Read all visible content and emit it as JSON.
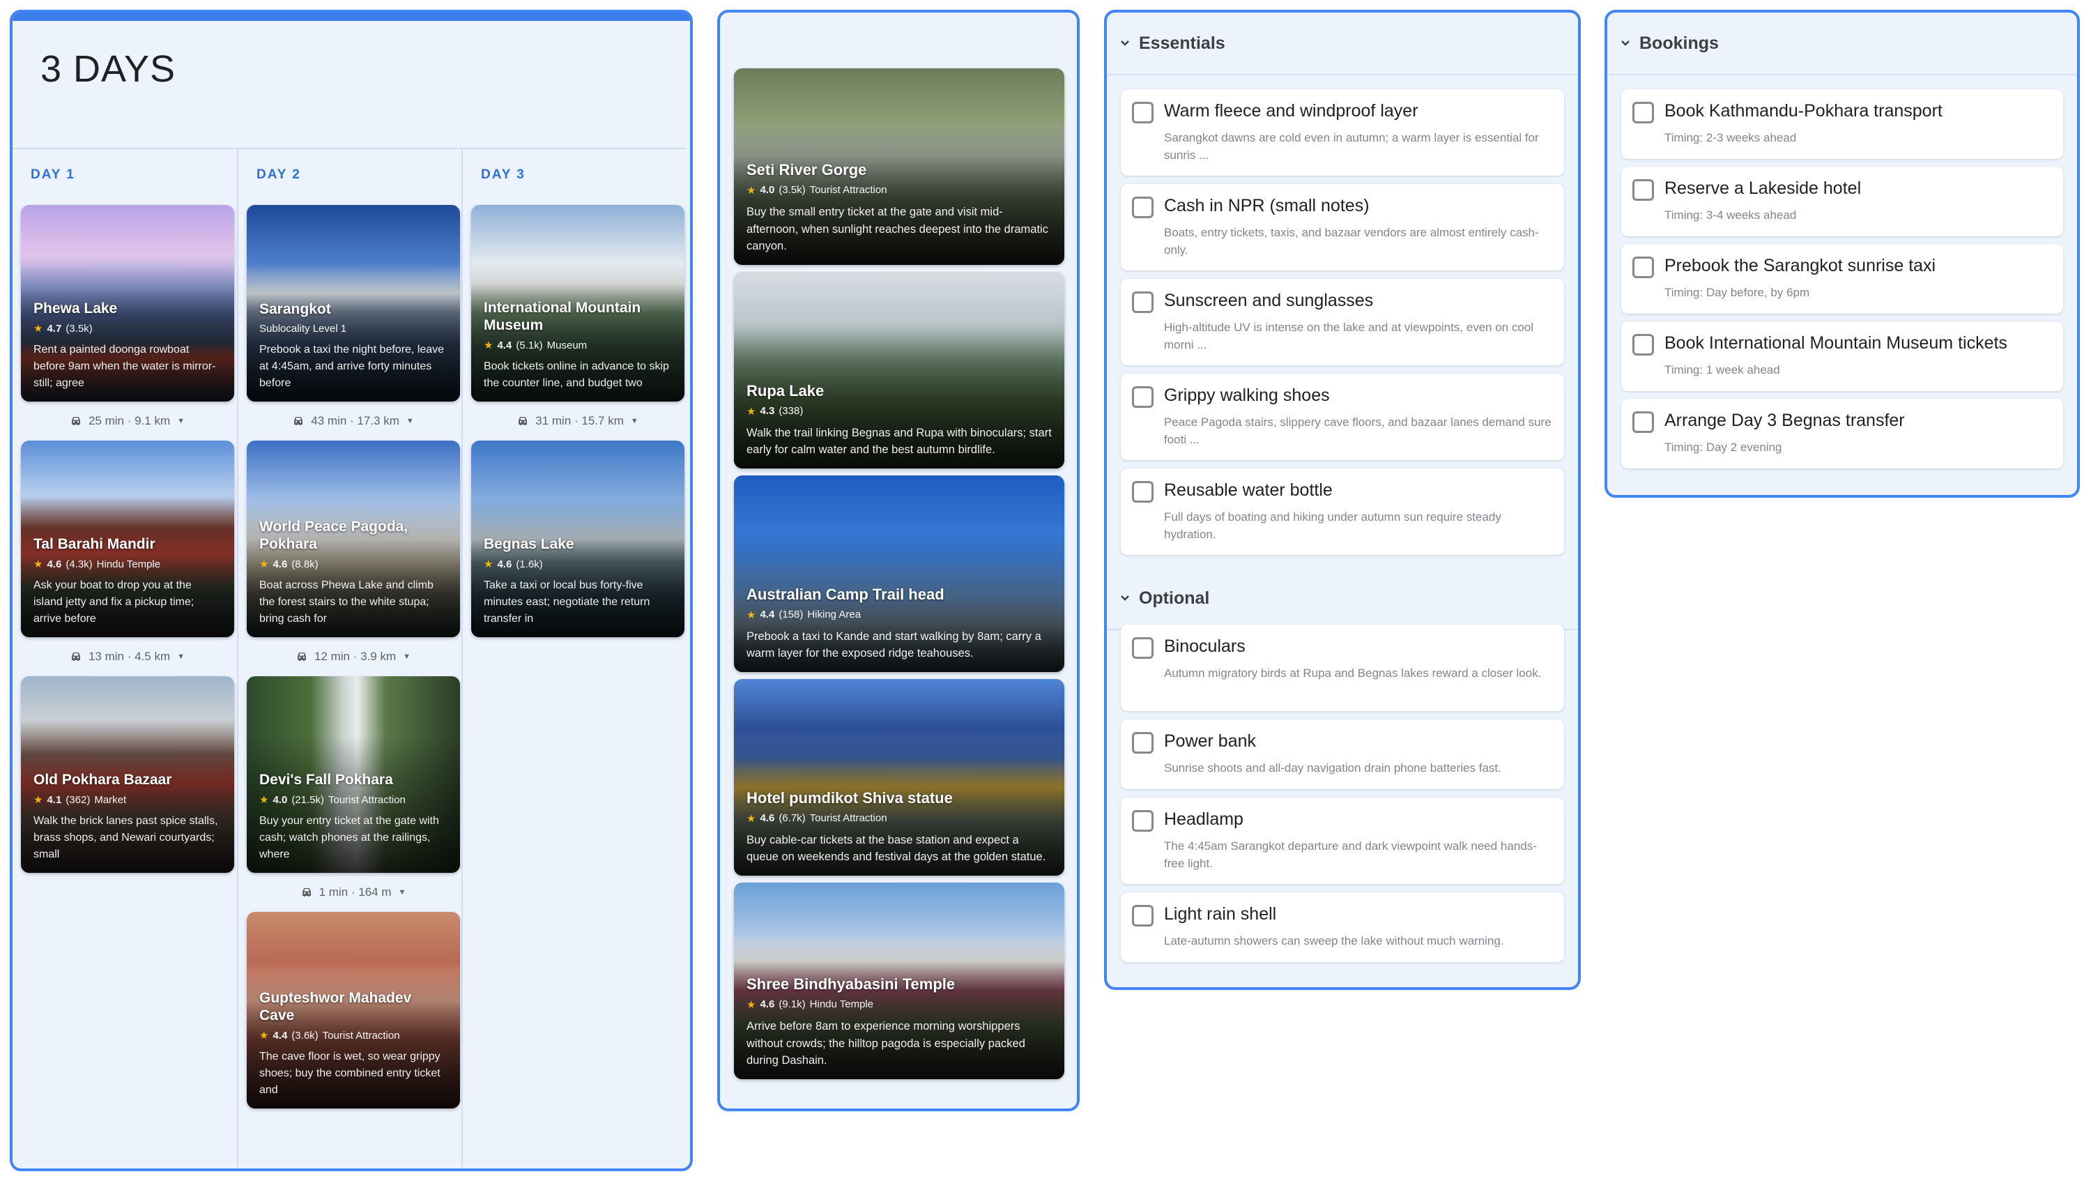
{
  "colors": {
    "accent": "#4285f4",
    "panel_bg": "#edf3fd",
    "star": "#fbbc04",
    "day_label": "#2b6fd9"
  },
  "itinerary": {
    "title": "3 DAYS",
    "days": [
      {
        "label": "DAY 1",
        "places": [
          {
            "name": "Phewa Lake",
            "rating": "4.7",
            "count": "(3.5k)",
            "category": "",
            "desc": "Rent a painted doonga rowboat before 9am when the water is mirror-still; agree"
          },
          {
            "name": "Tal Barahi Mandir",
            "rating": "4.6",
            "count": "(4.3k)",
            "category": "Hindu Temple",
            "desc": "Ask your boat to drop you at the island jetty and fix a pickup time; arrive before"
          },
          {
            "name": "Old Pokhara Bazaar",
            "rating": "4.1",
            "count": "(362)",
            "category": "Market",
            "desc": "Walk the brick lanes past spice stalls, brass shops, and Newari courtyards; small"
          }
        ],
        "transits": [
          "25 min · 9.1 km",
          "13 min · 4.5 km"
        ]
      },
      {
        "label": "DAY 2",
        "places": [
          {
            "name": "Sarangkot",
            "rating": "",
            "count": "",
            "category": "Sublocality Level 1",
            "desc": "Prebook a taxi the night before, leave at 4:45am, and arrive forty minutes before"
          },
          {
            "name": "World Peace Pagoda, Pokhara",
            "rating": "4.6",
            "count": "(8.8k)",
            "category": "",
            "desc": "Boat across Phewa Lake and climb the forest stairs to the white stupa; bring cash for"
          },
          {
            "name": "Devi's Fall Pokhara",
            "rating": "4.0",
            "count": "(21.5k)",
            "category": "Tourist Attraction",
            "desc": "Buy your entry ticket at the gate with cash; watch phones at the railings, where"
          },
          {
            "name": "Gupteshwor Mahadev Cave",
            "rating": "4.4",
            "count": "(3.6k)",
            "category": "Tourist Attraction",
            "desc": "The cave floor is wet, so wear grippy shoes; buy the combined entry ticket and"
          }
        ],
        "transits": [
          "43 min · 17.3 km",
          "12 min · 3.9 km",
          "1 min · 164 m"
        ]
      },
      {
        "label": "DAY 3",
        "places": [
          {
            "name": "International Mountain Museum",
            "rating": "4.4",
            "count": "(5.1k)",
            "category": "Museum",
            "desc": "Book tickets online in advance to skip the counter line, and budget two"
          },
          {
            "name": "Begnas Lake",
            "rating": "4.6",
            "count": "(1.6k)",
            "category": "",
            "desc": "Take a taxi or local bus forty-five minutes east; negotiate the return transfer in"
          }
        ],
        "transits": [
          "31 min · 15.7 km"
        ]
      }
    ]
  },
  "photo_cards": [
    {
      "name": "Seti River Gorge",
      "rating": "4.0",
      "count": "(3.5k)",
      "category": "Tourist Attraction",
      "desc": "Buy the small entry ticket at the gate and visit mid-afternoon, when sunlight reaches deepest into the dramatic canyon."
    },
    {
      "name": "Rupa Lake",
      "rating": "4.3",
      "count": "(338)",
      "category": "",
      "desc": "Walk the trail linking Begnas and Rupa with binoculars; start early for calm water and the best autumn birdlife."
    },
    {
      "name": "Australian Camp Trail head",
      "rating": "4.4",
      "count": "(158)",
      "category": "Hiking Area",
      "desc": "Prebook a taxi to Kande and start walking by 8am; carry a warm layer for the exposed ridge teahouses."
    },
    {
      "name": "Hotel pumdikot Shiva statue",
      "rating": "4.6",
      "count": "(6.7k)",
      "category": "Tourist Attraction",
      "desc": "Buy cable-car tickets at the base station and expect a queue on weekends and festival days at the golden statue."
    },
    {
      "name": "Shree Bindhyabasini Temple",
      "rating": "4.6",
      "count": "(9.1k)",
      "category": "Hindu Temple",
      "desc": "Arrive before 8am to experience morning worshippers without crowds; the hilltop pagoda is especially packed during Dashain."
    }
  ],
  "checklist": {
    "essentials_title": "Essentials",
    "essentials": [
      {
        "label": "Warm fleece and windproof layer",
        "note": "Sarangkot dawns are cold even in autumn; a warm layer is essential for sunris ..."
      },
      {
        "label": "Cash in NPR (small notes)",
        "note": "Boats, entry tickets, taxis, and bazaar vendors are almost entirely cash-only."
      },
      {
        "label": "Sunscreen and sunglasses",
        "note": "High-altitude UV is intense on the lake and at viewpoints, even on cool morni ..."
      },
      {
        "label": "Grippy walking shoes",
        "note": "Peace Pagoda stairs, slippery cave floors, and bazaar lanes demand sure footi ..."
      },
      {
        "label": "Reusable water bottle",
        "note": "Full days of boating and hiking under autumn sun require steady hydration."
      }
    ],
    "optional_title": "Optional",
    "optional": [
      {
        "label": "Binoculars",
        "note": "Autumn migratory birds at Rupa and Begnas lakes reward a closer look."
      },
      {
        "label": "Power bank",
        "note": "Sunrise shoots and all-day navigation drain phone batteries fast."
      },
      {
        "label": "Headlamp",
        "note": "The 4:45am Sarangkot departure and dark viewpoint walk need hands-free light."
      },
      {
        "label": "Light rain shell",
        "note": "Late-autumn showers can sweep the lake without much warning."
      }
    ]
  },
  "bookings": {
    "title": "Bookings",
    "items": [
      {
        "label": "Book Kathmandu-Pokhara transport",
        "timing": "Timing: 2-3 weeks ahead"
      },
      {
        "label": "Reserve a Lakeside hotel",
        "timing": "Timing: 3-4 weeks ahead"
      },
      {
        "label": "Prebook the Sarangkot sunrise taxi",
        "timing": "Timing: Day before, by 6pm"
      },
      {
        "label": "Book International Mountain Museum tickets",
        "timing": "Timing: 1 week ahead"
      },
      {
        "label": "Arrange Day 3 Begnas transfer",
        "timing": "Timing: Day 2 evening"
      }
    ]
  }
}
